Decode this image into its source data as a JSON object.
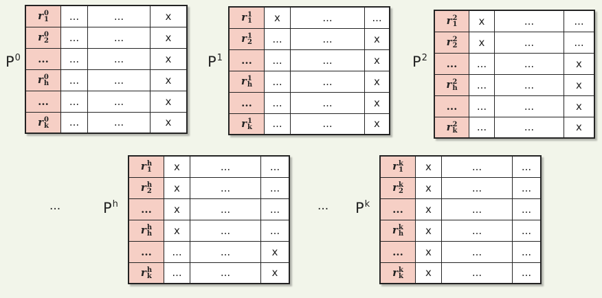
{
  "labels": {
    "p0": "P",
    "p0_sup": "0",
    "p1": "P",
    "p1_sup": "1",
    "p2": "P",
    "p2_sup": "2",
    "ph": "P",
    "ph_sup": "h",
    "pk": "P",
    "pk_sup": "k"
  },
  "ellipses": {
    "left": "...",
    "middle": "..."
  },
  "matrices": {
    "p0": {
      "rows": [
        {
          "r": "r",
          "sup": "0",
          "sub": "1",
          "c": [
            "...",
            "...",
            "x"
          ]
        },
        {
          "r": "r",
          "sup": "0",
          "sub": "2",
          "c": [
            "...",
            "...",
            "x"
          ]
        },
        {
          "r": "...",
          "c": [
            "...",
            "...",
            "x"
          ]
        },
        {
          "r": "r",
          "sup": "0",
          "sub": "h",
          "c": [
            "...",
            "...",
            "x"
          ]
        },
        {
          "r": "...",
          "c": [
            "...",
            "...",
            "x"
          ]
        },
        {
          "r": "r",
          "sup": "0",
          "sub": "k",
          "c": [
            "...",
            "...",
            "x"
          ]
        }
      ]
    },
    "p1": {
      "rows": [
        {
          "r": "r",
          "sup": "1",
          "sub": "1",
          "c": [
            "x",
            "...",
            "..."
          ]
        },
        {
          "r": "r",
          "sup": "1",
          "sub": "2",
          "c": [
            "...",
            "...",
            "x"
          ]
        },
        {
          "r": "...",
          "c": [
            "...",
            "...",
            "x"
          ]
        },
        {
          "r": "r",
          "sup": "1",
          "sub": "h",
          "c": [
            "...",
            "...",
            "x"
          ]
        },
        {
          "r": "...",
          "c": [
            "...",
            "...",
            "x"
          ]
        },
        {
          "r": "r",
          "sup": "1",
          "sub": "k",
          "c": [
            "...",
            "...",
            "x"
          ]
        }
      ]
    },
    "p2": {
      "rows": [
        {
          "r": "r",
          "sup": "2",
          "sub": "1",
          "c": [
            "x",
            "...",
            "..."
          ]
        },
        {
          "r": "r",
          "sup": "2",
          "sub": "2",
          "c": [
            "x",
            "...",
            "..."
          ]
        },
        {
          "r": "...",
          "c": [
            "...",
            "...",
            "x"
          ]
        },
        {
          "r": "r",
          "sup": "2",
          "sub": "h",
          "c": [
            "...",
            "...",
            "x"
          ]
        },
        {
          "r": "...",
          "c": [
            "...",
            "...",
            "x"
          ]
        },
        {
          "r": "r",
          "sup": "2",
          "sub": "k",
          "c": [
            "...",
            "...",
            "x"
          ]
        }
      ]
    },
    "ph": {
      "rows": [
        {
          "r": "r",
          "sup": "h",
          "sub": "1",
          "c": [
            "x",
            "...",
            "..."
          ]
        },
        {
          "r": "r",
          "sup": "h",
          "sub": "2",
          "c": [
            "x",
            "...",
            "..."
          ]
        },
        {
          "r": "...",
          "c": [
            "x",
            "...",
            "..."
          ]
        },
        {
          "r": "r",
          "sup": "h",
          "sub": "h",
          "c": [
            "x",
            "...",
            "..."
          ]
        },
        {
          "r": "...",
          "c": [
            "...",
            "...",
            "x"
          ]
        },
        {
          "r": "r",
          "sup": "h",
          "sub": "k",
          "c": [
            "...",
            "...",
            "x"
          ]
        }
      ]
    },
    "pk": {
      "rows": [
        {
          "r": "r",
          "sup": "k",
          "sub": "1",
          "c": [
            "x",
            "...",
            "..."
          ]
        },
        {
          "r": "r",
          "sup": "k",
          "sub": "2",
          "c": [
            "x",
            "...",
            "..."
          ]
        },
        {
          "r": "...",
          "c": [
            "x",
            "...",
            "..."
          ]
        },
        {
          "r": "r",
          "sup": "k",
          "sub": "h",
          "c": [
            "x",
            "...",
            "..."
          ]
        },
        {
          "r": "...",
          "c": [
            "x",
            "...",
            "..."
          ]
        },
        {
          "r": "r",
          "sup": "k",
          "sub": "k",
          "c": [
            "x",
            "...",
            "..."
          ]
        }
      ]
    }
  }
}
